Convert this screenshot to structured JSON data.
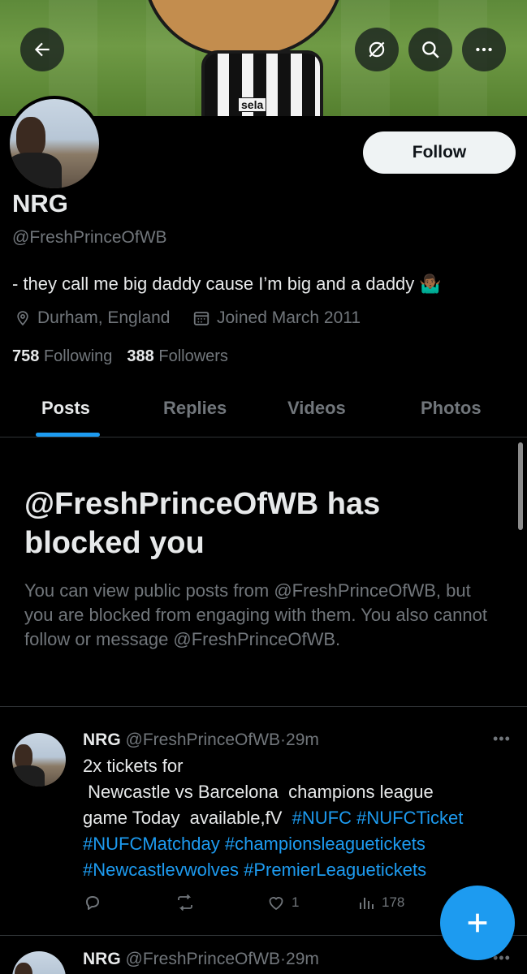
{
  "banner": {
    "sponsor_text": "sela"
  },
  "header": {
    "back_icon": "back-arrow-icon",
    "translate_icon": "translate-icon",
    "search_icon": "search-icon",
    "more_icon": "more-icon"
  },
  "profile": {
    "follow_label": "Follow",
    "name": "NRG",
    "handle": "@FreshPrinceOfWB",
    "bio": "- they call me big daddy cause I’m big and a daddy 🤷🏾‍♂️",
    "location": "Durham, England",
    "joined": "Joined March 2011",
    "following_count": "758",
    "following_label": "Following",
    "followers_count": "388",
    "followers_label": "Followers"
  },
  "tabs": [
    {
      "label": "Posts",
      "active": true
    },
    {
      "label": "Replies",
      "active": false
    },
    {
      "label": "Videos",
      "active": false
    },
    {
      "label": "Photos",
      "active": false
    }
  ],
  "blocked": {
    "title": "@FreshPrinceOfWB has blocked you",
    "description": "You can view public posts from @FreshPrinceOfWB, but you are blocked from engaging with them. You also cannot follow or message @FreshPrinceOfWB."
  },
  "posts": [
    {
      "author": "NRG",
      "handle": "@FreshPrinceOfWB",
      "sep": "·",
      "time": "29m",
      "line1": "2x tickets for",
      "line2": " Newcastle vs Barcelona  champions league",
      "line3": "game Today  available,fV ",
      "tags": [
        "#NUFC",
        "#NUFCTicket",
        "#NUFCMatchday",
        "#championsleaguetickets",
        "#Newcastlevwolves",
        "#PremierLeaguetickets"
      ],
      "likes": "1",
      "views": "178"
    },
    {
      "author": "NRG",
      "handle": "@FreshPrinceOfWB",
      "sep": "·",
      "time": "29m"
    }
  ],
  "fab": {
    "icon": "plus-icon"
  },
  "colors": {
    "accent": "#1d9bf0",
    "background": "#000000",
    "muted": "#71767b",
    "text": "#e7e9ea"
  }
}
